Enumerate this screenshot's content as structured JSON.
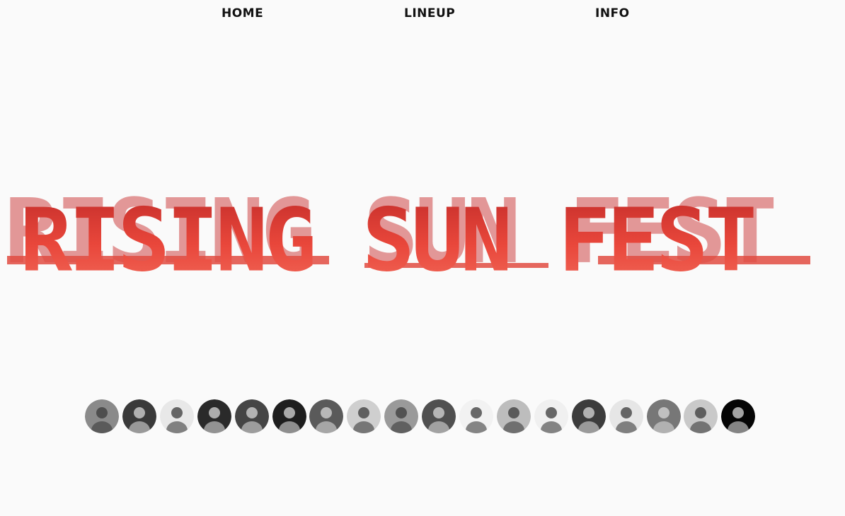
{
  "nav": {
    "home": "HOME",
    "lineup": "LINEUP",
    "info": "INFO"
  },
  "hero": {
    "title": "RISING SUN FEST"
  },
  "colors": {
    "accent_dark": "#c8302c",
    "accent_light": "#f06455",
    "background": "#fafafa",
    "nav_text": "#111111"
  },
  "artists": [
    {
      "name": "artist-avatar-1",
      "tone": "#8a8a8a"
    },
    {
      "name": "artist-avatar-2",
      "tone": "#3a3a3a"
    },
    {
      "name": "artist-avatar-3",
      "tone": "#e8e8e8"
    },
    {
      "name": "artist-avatar-4",
      "tone": "#2a2a2a"
    },
    {
      "name": "artist-avatar-5",
      "tone": "#454545"
    },
    {
      "name": "artist-avatar-6",
      "tone": "#1e1e1e"
    },
    {
      "name": "artist-avatar-7",
      "tone": "#5a5a5a"
    },
    {
      "name": "artist-avatar-8",
      "tone": "#cfcfcf"
    },
    {
      "name": "artist-avatar-9",
      "tone": "#9a9a9a"
    },
    {
      "name": "artist-avatar-10",
      "tone": "#505050"
    },
    {
      "name": "artist-avatar-11",
      "tone": "#f2f2f2"
    },
    {
      "name": "artist-avatar-12",
      "tone": "#bdbdbd"
    },
    {
      "name": "artist-avatar-13",
      "tone": "#f0f0f0"
    },
    {
      "name": "artist-avatar-14",
      "tone": "#3c3c3c"
    },
    {
      "name": "artist-avatar-15",
      "tone": "#e6e6e6"
    },
    {
      "name": "artist-avatar-16",
      "tone": "#777777"
    },
    {
      "name": "artist-avatar-17",
      "tone": "#c9c9c9"
    },
    {
      "name": "artist-avatar-18",
      "tone": "#050505"
    }
  ]
}
